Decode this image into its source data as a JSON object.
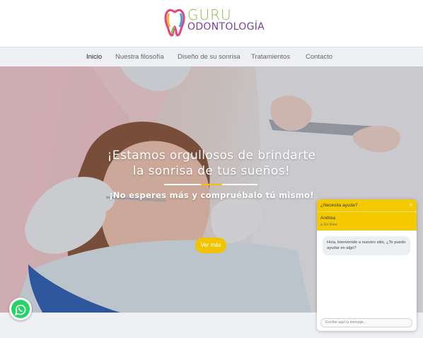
{
  "brand": {
    "logo_line1": "GURU",
    "logo_line2": "ODONTOLOGÍA",
    "accent_yellow": "#f2c400",
    "green": "#8fb84a",
    "purple": "#7b3fa0"
  },
  "nav": {
    "items": [
      {
        "label": "Inicio",
        "active": true
      },
      {
        "label": "Nuestra filosofía",
        "active": false
      },
      {
        "label": "Diseño de su sonrisa",
        "active": false
      },
      {
        "label": "Tratamientos",
        "active": false
      },
      {
        "label": "Contacto",
        "active": false
      }
    ]
  },
  "hero": {
    "title_line1": "¡Estamos orgullosos de brindarte",
    "title_line2": "la sonrisa de tus sueños!",
    "subtitle": "¡No esperes más y compruébalo tú mismo!",
    "cta_label": "Ver más"
  },
  "chat": {
    "header_question": "¿Necesita ayuda?",
    "close_icon": "×",
    "agent_name": "Andrea",
    "agent_status": "En línea",
    "message": "Hola, bienvenido a nuestro sitio, ¿Te puedo ayudar en algo?",
    "input_placeholder": "Escribe aquí tu mensaje..."
  },
  "icons": {
    "whatsapp": "whatsapp-icon",
    "logo_mark": "tooth-logo-icon"
  }
}
